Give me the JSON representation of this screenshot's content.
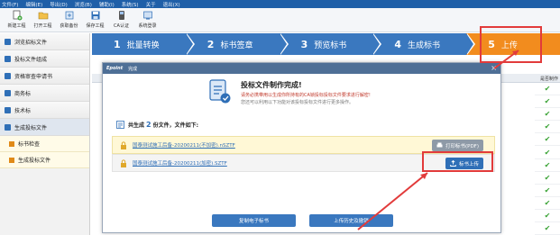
{
  "menu": [
    "文件(F)",
    "编辑(E)",
    "导出(D)",
    "浏览(B)",
    "辅助(I)",
    "系统(S)",
    "关于",
    "退出(X)"
  ],
  "toolbar": [
    {
      "label": "新建工程",
      "icon": "new-project-icon"
    },
    {
      "label": "打开工程",
      "icon": "open-project-icon"
    },
    {
      "label": "获取备份",
      "icon": "backup-icon"
    },
    {
      "label": "保存工程",
      "icon": "save-icon"
    },
    {
      "label": "CA认证",
      "icon": "ca-cert-icon"
    },
    {
      "label": "系统登录",
      "icon": "login-icon"
    }
  ],
  "sidebar": {
    "items": [
      "浏览招标文件",
      "投标文件组成",
      "资格审查申请书",
      "商务标",
      "技术标",
      "生成投标文件"
    ],
    "subitems": [
      "标书检查",
      "生成投标文件"
    ]
  },
  "steps": [
    {
      "num": "1",
      "label": "批量转换"
    },
    {
      "num": "2",
      "label": "标书签章"
    },
    {
      "num": "3",
      "label": "预览标书"
    },
    {
      "num": "4",
      "label": "生成标书"
    },
    {
      "num": "5",
      "label": "上传"
    }
  ],
  "table": {
    "header": "是否制作"
  },
  "dialog": {
    "logo": "Epoint",
    "title": "完成",
    "close": "×",
    "heading": "投标文件制作完成!",
    "sub1": "请务必携带用以生成你所持有的CA锁投标投标文件要求进行解密!",
    "sub2": "您还可以利用以下功能对该投标投标文件进行更多操作。",
    "summary_prefix": "共生成",
    "summary_count": "2",
    "summary_suffix": "份文件，文件如下:",
    "files": [
      {
        "name": "国泰测试施工后备-20200211(不加密).nSZTF",
        "button": "打印标书(PDF)"
      },
      {
        "name": "国泰测试施工后备-20200211(加密).SZTF",
        "button": "标书上传"
      }
    ],
    "bottom_buttons": [
      "复制电子标书",
      "上传历史及撤销"
    ]
  },
  "colors": {
    "accent": "#3a78bf",
    "current_step": "#f28c1e",
    "annotation": "#e23b3b",
    "check": "#3aa335"
  }
}
